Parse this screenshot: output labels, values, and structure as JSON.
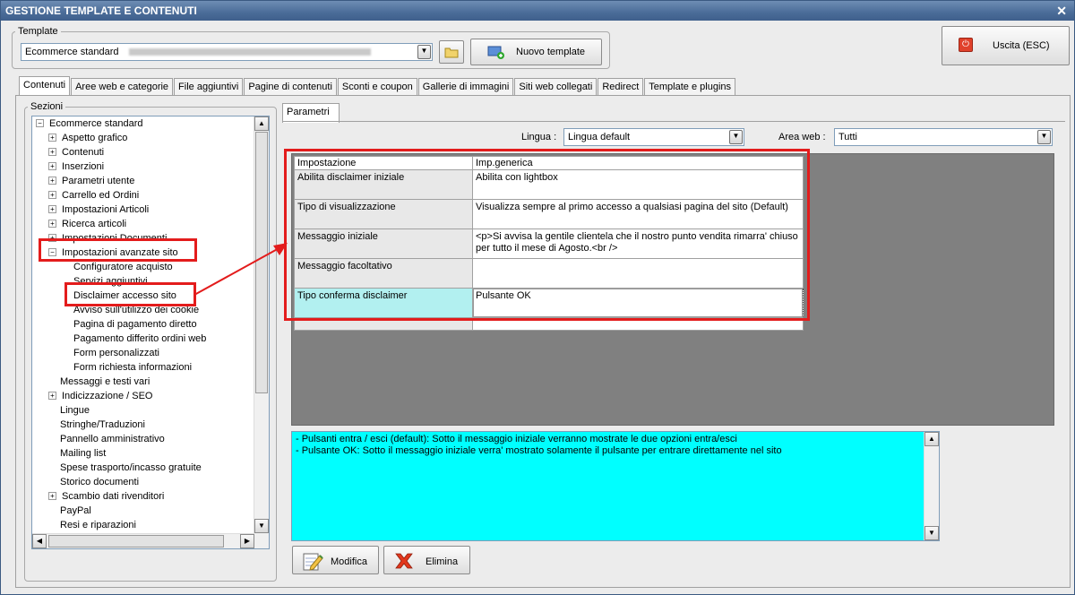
{
  "window": {
    "title": "GESTIONE TEMPLATE E CONTENUTI",
    "close_glyph": "✕"
  },
  "template_group": {
    "label": "Template",
    "selected": "Ecommerce standard",
    "new_template_button": "Nuovo template"
  },
  "exit_button": {
    "label": "Uscita (ESC)",
    "icon": "power-icon"
  },
  "tabs": [
    "Contenuti",
    "Aree web e categorie",
    "File aggiuntivi",
    "Pagine di contenuti",
    "Sconti e coupon",
    "Gallerie di immagini",
    "Siti web collegati",
    "Redirect",
    "Template e plugins"
  ],
  "sections": {
    "label": "Sezioni",
    "tree": [
      {
        "label": "Ecommerce standard",
        "expander": "−"
      },
      {
        "label": "Aspetto grafico",
        "expander": "+"
      },
      {
        "label": "Contenuti",
        "expander": "+"
      },
      {
        "label": "Inserzioni",
        "expander": "+"
      },
      {
        "label": "Parametri utente",
        "expander": "+"
      },
      {
        "label": "Carrello ed Ordini",
        "expander": "+"
      },
      {
        "label": "Impostazioni Articoli",
        "expander": "+"
      },
      {
        "label": "Ricerca articoli",
        "expander": "+"
      },
      {
        "label": "Impostazioni Documenti",
        "expander": "+"
      },
      {
        "label": "Impostazioni avanzate sito",
        "expander": "−"
      },
      {
        "label": "Configuratore acquisto",
        "expander": ""
      },
      {
        "label": "Servizi aggiuntivi",
        "expander": ""
      },
      {
        "label": "Disclaimer accesso sito",
        "expander": ""
      },
      {
        "label": "Avviso sull'utilizzo dei cookie",
        "expander": ""
      },
      {
        "label": "Pagina di pagamento diretto",
        "expander": ""
      },
      {
        "label": "Pagamento differito ordini web",
        "expander": ""
      },
      {
        "label": "Form personalizzati",
        "expander": ""
      },
      {
        "label": "Form richiesta informazioni",
        "expander": ""
      },
      {
        "label": "Messaggi e testi vari",
        "expander": ""
      },
      {
        "label": "Indicizzazione / SEO",
        "expander": "+"
      },
      {
        "label": "Lingue",
        "expander": ""
      },
      {
        "label": "Stringhe/Traduzioni",
        "expander": ""
      },
      {
        "label": "Pannello amministrativo",
        "expander": ""
      },
      {
        "label": "Mailing list",
        "expander": ""
      },
      {
        "label": "Spese trasporto/incasso gratuite",
        "expander": ""
      },
      {
        "label": "Storico documenti",
        "expander": ""
      },
      {
        "label": "Scambio dati rivenditori",
        "expander": "+"
      },
      {
        "label": "PayPal",
        "expander": ""
      },
      {
        "label": "Resi e riparazioni",
        "expander": ""
      }
    ]
  },
  "parametri_tab": "Parametri",
  "filters": {
    "lingua_label": "Lingua :",
    "lingua_value": "Lingua default",
    "area_label": "Area web :",
    "area_value": "Tutti"
  },
  "table": {
    "headers": [
      "Impostazione",
      "Imp.generica"
    ],
    "rows": [
      {
        "key": "Abilita disclaimer iniziale",
        "value": "Abilita con lightbox"
      },
      {
        "key": "Tipo di visualizzazione",
        "value": "Visualizza sempre al primo accesso a qualsiasi pagina del sito (Default)"
      },
      {
        "key": "Messaggio iniziale",
        "value": "<p>Si avvisa la gentile clientela che il nostro punto vendita rimarra' chiuso per tutto il mese di Agosto.<br />"
      },
      {
        "key": "Messaggio facoltativo",
        "value": ""
      },
      {
        "key": "Tipo conferma disclaimer",
        "value": "Pulsante OK"
      }
    ]
  },
  "notes": {
    "line1": "- Pulsanti entra / esci (default): Sotto il messaggio iniziale verranno mostrate le due opzioni entra/esci",
    "line2": "- Pulsante OK: Sotto il messaggio iniziale verra' mostrato solamente il pulsante per entrare direttamente nel sito"
  },
  "actions": {
    "edit": "Modifica",
    "delete": "Elimina"
  },
  "colors": {
    "highlight": "#e31c1c",
    "notes_bg": "#00ffff",
    "selected_row": "#b2f0f0"
  }
}
